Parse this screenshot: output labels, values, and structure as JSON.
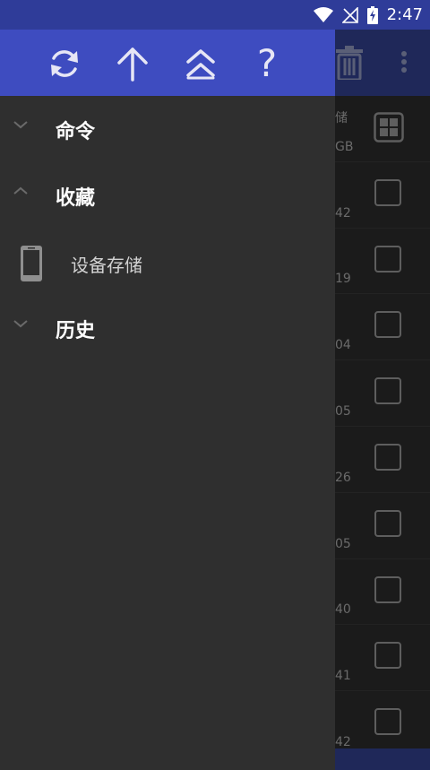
{
  "status_bar": {
    "time": "2:47"
  },
  "background_list": {
    "rows": [
      {
        "meta_top": "储",
        "meta": "GB",
        "kind": "grid"
      },
      {
        "meta": "42"
      },
      {
        "meta": "19"
      },
      {
        "meta": "04"
      },
      {
        "meta": "05"
      },
      {
        "meta": "26"
      },
      {
        "meta": "05"
      },
      {
        "meta": "40"
      },
      {
        "meta": "41"
      },
      {
        "meta": "42"
      }
    ]
  },
  "drawer": {
    "toolbar": {
      "refresh_icon": "refresh-icon",
      "up_icon": "arrow-up-icon",
      "top_icon": "double-chevron-up-icon",
      "help_label": "?"
    },
    "sections": {
      "commands": {
        "label": "命令",
        "expanded": false
      },
      "favorites": {
        "label": "收藏",
        "expanded": true
      },
      "history": {
        "label": "历史",
        "expanded": false
      }
    },
    "favorites_items": [
      {
        "label": "设备存储",
        "icon": "phone-icon"
      }
    ]
  },
  "colors": {
    "status_bar": "#2f3c99",
    "drawer_toolbar": "#3e4cc0",
    "drawer_bg": "#2f2f2f",
    "app_bg": "#1b1b1b"
  }
}
